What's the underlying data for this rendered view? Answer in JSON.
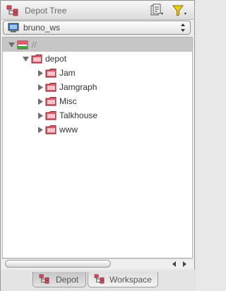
{
  "header": {
    "title": "Depot Tree",
    "sync_icon": "sync-icon",
    "filter_icon": "filter-icon"
  },
  "workspace": {
    "selected": "bruno_ws",
    "icon": "computer-icon"
  },
  "tree": {
    "root": {
      "label": "//",
      "expanded": true,
      "selected": true
    },
    "depot": {
      "label": "depot",
      "expanded": true
    },
    "children": [
      {
        "label": "Jam"
      },
      {
        "label": "Jamgraph"
      },
      {
        "label": "Misc"
      },
      {
        "label": "Talkhouse"
      },
      {
        "label": "www"
      }
    ]
  },
  "tabs": [
    {
      "label": "Depot",
      "active": true
    },
    {
      "label": "Workspace",
      "active": false
    }
  ],
  "colors": {
    "folder": "#e05a6a",
    "selection": "#c6c6c6"
  }
}
